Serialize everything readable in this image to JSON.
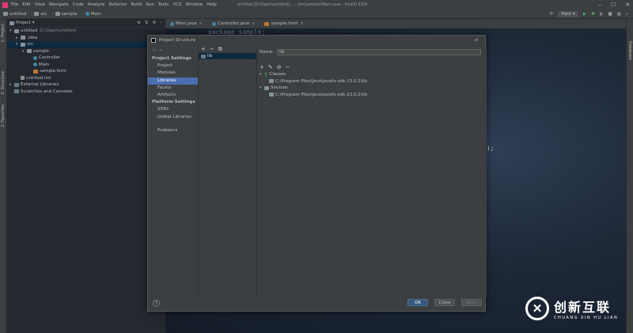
{
  "menubar": {
    "items": [
      "File",
      "Edit",
      "View",
      "Navigate",
      "Code",
      "Analyze",
      "Refactor",
      "Build",
      "Run",
      "Tools",
      "VCS",
      "Window",
      "Help"
    ],
    "window_title": "untitled [D:\\Open\\untitled] - ...\\src\\sample\\Main.java - IntelliJ IDEA"
  },
  "navbar": {
    "crumbs": [
      "untitled",
      "src",
      "sample",
      "Main"
    ],
    "run_config": "Main"
  },
  "left_tabs": [
    "1: Project",
    "2: Structure",
    "2: Favorites"
  ],
  "right_tabs": [
    "Database"
  ],
  "project_panel": {
    "header": "Project",
    "rows": [
      {
        "label": "untitled",
        "path": "D:\\Open\\untitled",
        "arrow": "▾",
        "icon": "folder",
        "indent": 0
      },
      {
        "label": ".idea",
        "arrow": "▸",
        "icon": "folder",
        "indent": 1
      },
      {
        "label": "src",
        "arrow": "▾",
        "icon": "folder",
        "indent": 1,
        "selected": true
      },
      {
        "label": "sample",
        "arrow": "▾",
        "icon": "folder",
        "indent": 2
      },
      {
        "label": "Controller",
        "icon": "class",
        "indent": 3
      },
      {
        "label": "Main",
        "icon": "class",
        "indent": 3
      },
      {
        "label": "sample.fxml",
        "icon": "fxml",
        "indent": 3
      },
      {
        "label": "untitled.iml",
        "icon": "iml",
        "indent": 1
      },
      {
        "label": "External Libraries",
        "arrow": "▸",
        "icon": "lib",
        "indent": 0
      },
      {
        "label": "Scratches and Consoles",
        "icon": "lib",
        "indent": 0
      }
    ]
  },
  "editor": {
    "tabs": [
      "Main.java",
      "Controller.java",
      "sample.fxml"
    ],
    "code_fragment_top": "package sample;",
    "code_fragment": "));"
  },
  "dialog": {
    "title": "Project Structure",
    "nav": {
      "section1": "Project Settings",
      "items1": [
        "Project",
        "Modules",
        "Libraries",
        "Facets",
        "Artifacts"
      ],
      "section2": "Platform Settings",
      "items2": [
        "SDKs",
        "Global Libraries"
      ],
      "problems": "Problems",
      "selected": "Libraries"
    },
    "library_item": "lib",
    "name_label": "Name:",
    "name_value": "lib",
    "tree": {
      "classes_label": "Classes",
      "classes_path": "C:\\Program Files\\Java\\javafx-sdk-13.0.2\\lib",
      "sources_label": "Sources",
      "sources_path": "C:\\Program Files\\Java\\javafx-sdk-13.0.2\\lib"
    },
    "buttons": {
      "ok": "OK",
      "cancel": "Close",
      "apply": "Apply"
    },
    "help": "?"
  },
  "watermark": {
    "cn": "创新互联",
    "en": "CHUANG XIN HU LIAN"
  }
}
